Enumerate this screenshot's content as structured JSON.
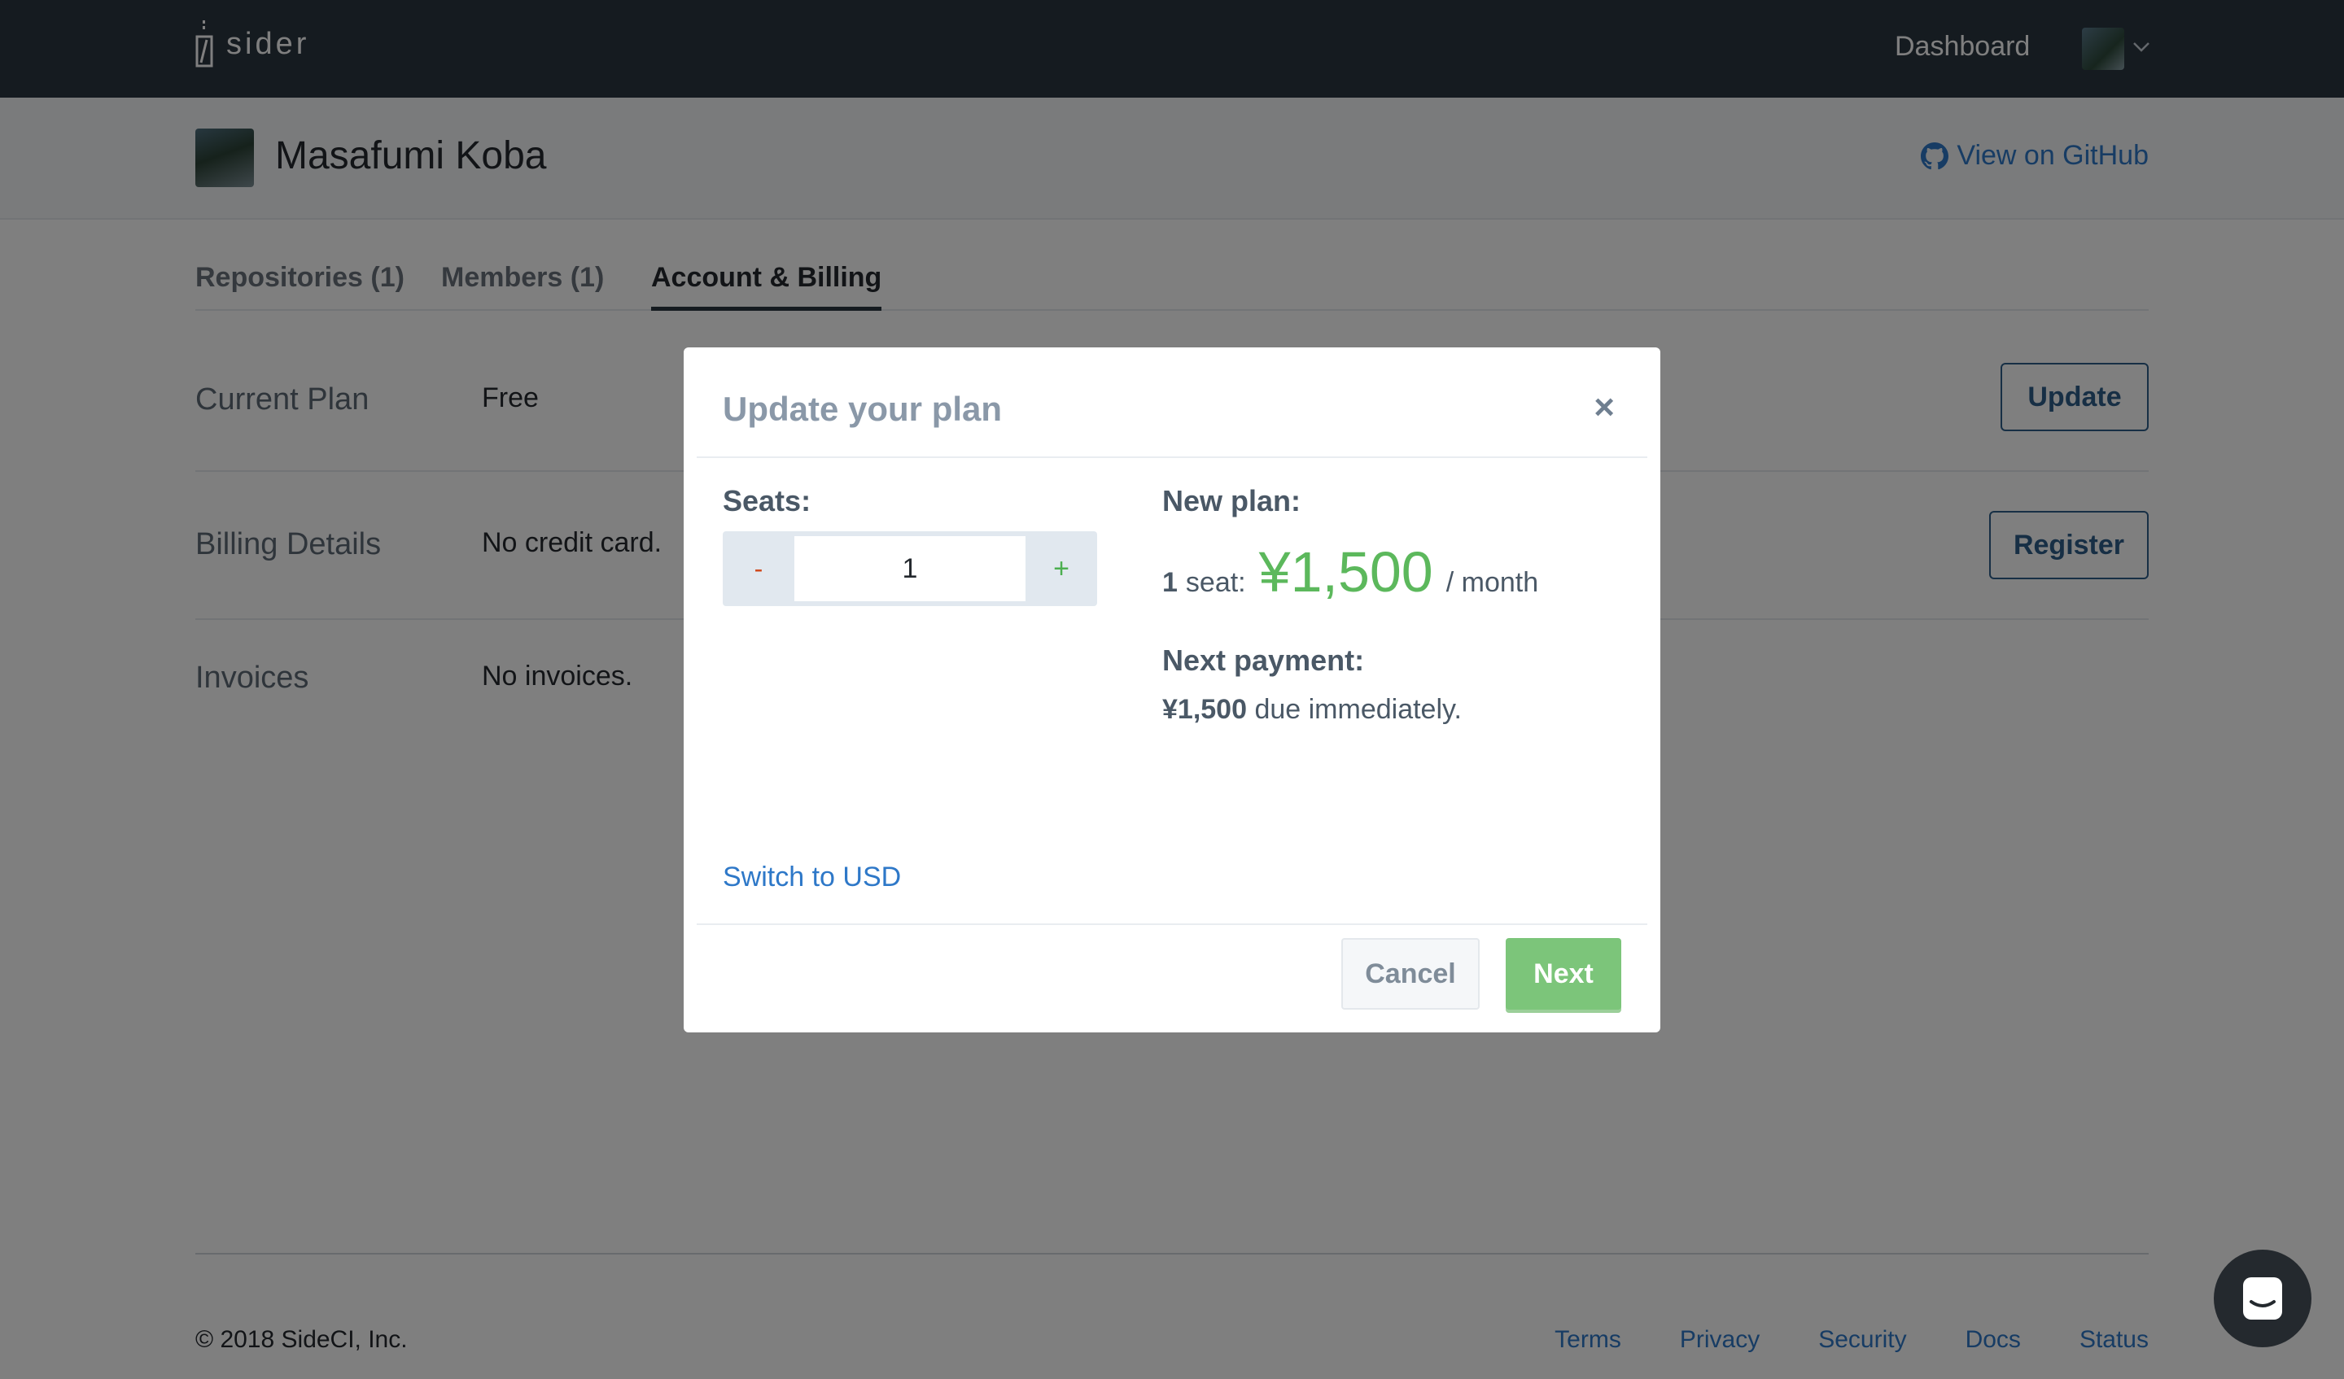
{
  "nav": {
    "logo_text": "sider",
    "dashboard_label": "Dashboard"
  },
  "account": {
    "name": "Masafumi Koba",
    "github_link": "View on GitHub"
  },
  "tabs": [
    {
      "label": "Repositories (1)",
      "active": false
    },
    {
      "label": "Members (1)",
      "active": false
    },
    {
      "label": "Account & Billing",
      "active": true
    }
  ],
  "rows": {
    "current_plan": {
      "label": "Current Plan",
      "value": "Free",
      "button": "Update"
    },
    "billing": {
      "label": "Billing Details",
      "value": "No credit card.",
      "button": "Register"
    },
    "invoices": {
      "label": "Invoices",
      "value": "No invoices."
    }
  },
  "modal": {
    "title": "Update your plan",
    "close_symbol": "×",
    "seats_label": "Seats:",
    "minus_label": "-",
    "plus_label": "+",
    "seats_value": "1",
    "new_plan_label": "New plan:",
    "seat_count": "1",
    "seat_word": "seat:",
    "price": "¥1,500",
    "per_month": "/ month",
    "next_payment_label": "Next payment:",
    "next_payment_amount": "¥1,500",
    "next_payment_suffix": " due immediately.",
    "switch_currency": "Switch to USD",
    "cancel_label": "Cancel",
    "next_label": "Next"
  },
  "footer": {
    "copyright": "© 2018 SideCI, Inc.",
    "links": [
      "Terms",
      "Privacy",
      "Security",
      "Docs",
      "Status"
    ]
  },
  "colors": {
    "topbar": "#2b3640",
    "link": "#2e78c8",
    "price_green": "#5cb85c",
    "next_button": "#7cc57a"
  }
}
